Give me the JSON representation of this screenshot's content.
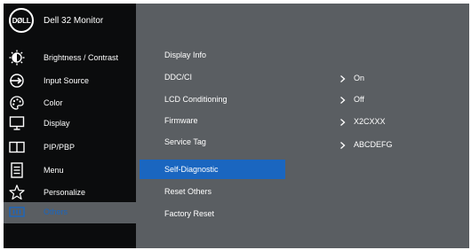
{
  "header": {
    "logo_text": "DØLL",
    "title": "Dell 32 Monitor"
  },
  "sidebar": {
    "items": [
      {
        "label": "Brightness / Contrast",
        "icon": "brightness-icon"
      },
      {
        "label": "Input Source",
        "icon": "input-source-icon"
      },
      {
        "label": "Color",
        "icon": "color-palette-icon"
      },
      {
        "label": "Display",
        "icon": "display-icon"
      },
      {
        "label": "PIP/PBP",
        "icon": "pip-pbp-icon"
      },
      {
        "label": "Menu",
        "icon": "menu-icon"
      },
      {
        "label": "Personalize",
        "icon": "star-icon"
      },
      {
        "label": "Others",
        "icon": "others-icon",
        "active": true
      }
    ]
  },
  "submenu": {
    "items": [
      {
        "label": "Display Info"
      },
      {
        "label": "DDC/CI"
      },
      {
        "label": "LCD Conditioning"
      },
      {
        "label": "Firmware"
      },
      {
        "label": "Service Tag"
      },
      {
        "label": "Self-Diagnostic",
        "selected": true
      },
      {
        "label": "Reset Others"
      },
      {
        "label": "Factory Reset"
      }
    ]
  },
  "values": [
    {
      "for": "DDC/CI",
      "text": "On"
    },
    {
      "for": "LCD Conditioning",
      "text": "Off"
    },
    {
      "for": "Firmware",
      "text": "X2CXXX"
    },
    {
      "for": "Service Tag",
      "text": "ABCDEFG"
    }
  ],
  "colors": {
    "panel": "#5a5e62",
    "sidebar": "#0b0c0d",
    "accent": "#1a66c0",
    "text": "#ffffff"
  }
}
